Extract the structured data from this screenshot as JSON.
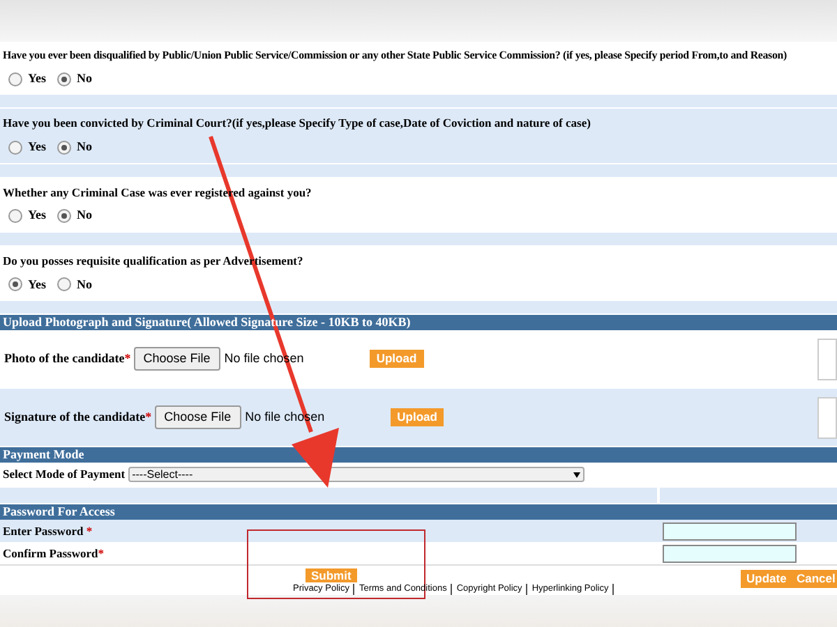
{
  "questions": [
    {
      "text": "Have you ever been disqualified by Public/Union Public Service/Commission or any other State Public Service Commission? (if yes, please Specify period From,to and Reason)",
      "options": [
        {
          "label": "Yes",
          "selected": false
        },
        {
          "label": "No",
          "selected": true
        }
      ]
    },
    {
      "text": "Have you been convicted by Criminal Court?(if yes,please Specify Type of case,Date of Coviction and nature of case)",
      "options": [
        {
          "label": "Yes",
          "selected": false
        },
        {
          "label": "No",
          "selected": true
        }
      ]
    },
    {
      "text": "Whether any Criminal Case was ever registered against you?",
      "options": [
        {
          "label": "Yes",
          "selected": false
        },
        {
          "label": "No",
          "selected": true
        }
      ]
    },
    {
      "text": "Do you posses requisite qualification as per Advertisement?",
      "options": [
        {
          "label": "Yes",
          "selected": true
        },
        {
          "label": "No",
          "selected": false
        }
      ]
    }
  ],
  "upload": {
    "header": "Upload Photograph and Signature( Allowed Signature Size - 10KB to 40KB)",
    "rows": [
      {
        "label": "Photo of the candidate",
        "required": "*",
        "button": "Choose File",
        "status": "No file chosen",
        "upload": "Upload"
      },
      {
        "label": "Signature of the candidate",
        "required": "*",
        "button": "Choose File",
        "status": "No file chosen",
        "upload": "Upload"
      }
    ]
  },
  "payment": {
    "header": "Payment Mode",
    "label": "Select Mode of Payment",
    "select": "----Select----"
  },
  "password": {
    "header": "Password For Access",
    "fields": [
      {
        "label": "Enter Password ",
        "required": "*"
      },
      {
        "label": "Confirm Password",
        "required": "*"
      }
    ]
  },
  "actions": {
    "submit": "Submit",
    "update": "Update",
    "cancel": "Cancel"
  },
  "footer_links": [
    "Privacy Policy",
    "Terms and Conditions",
    "Copyright Policy",
    "Hyperlinking Policy"
  ]
}
